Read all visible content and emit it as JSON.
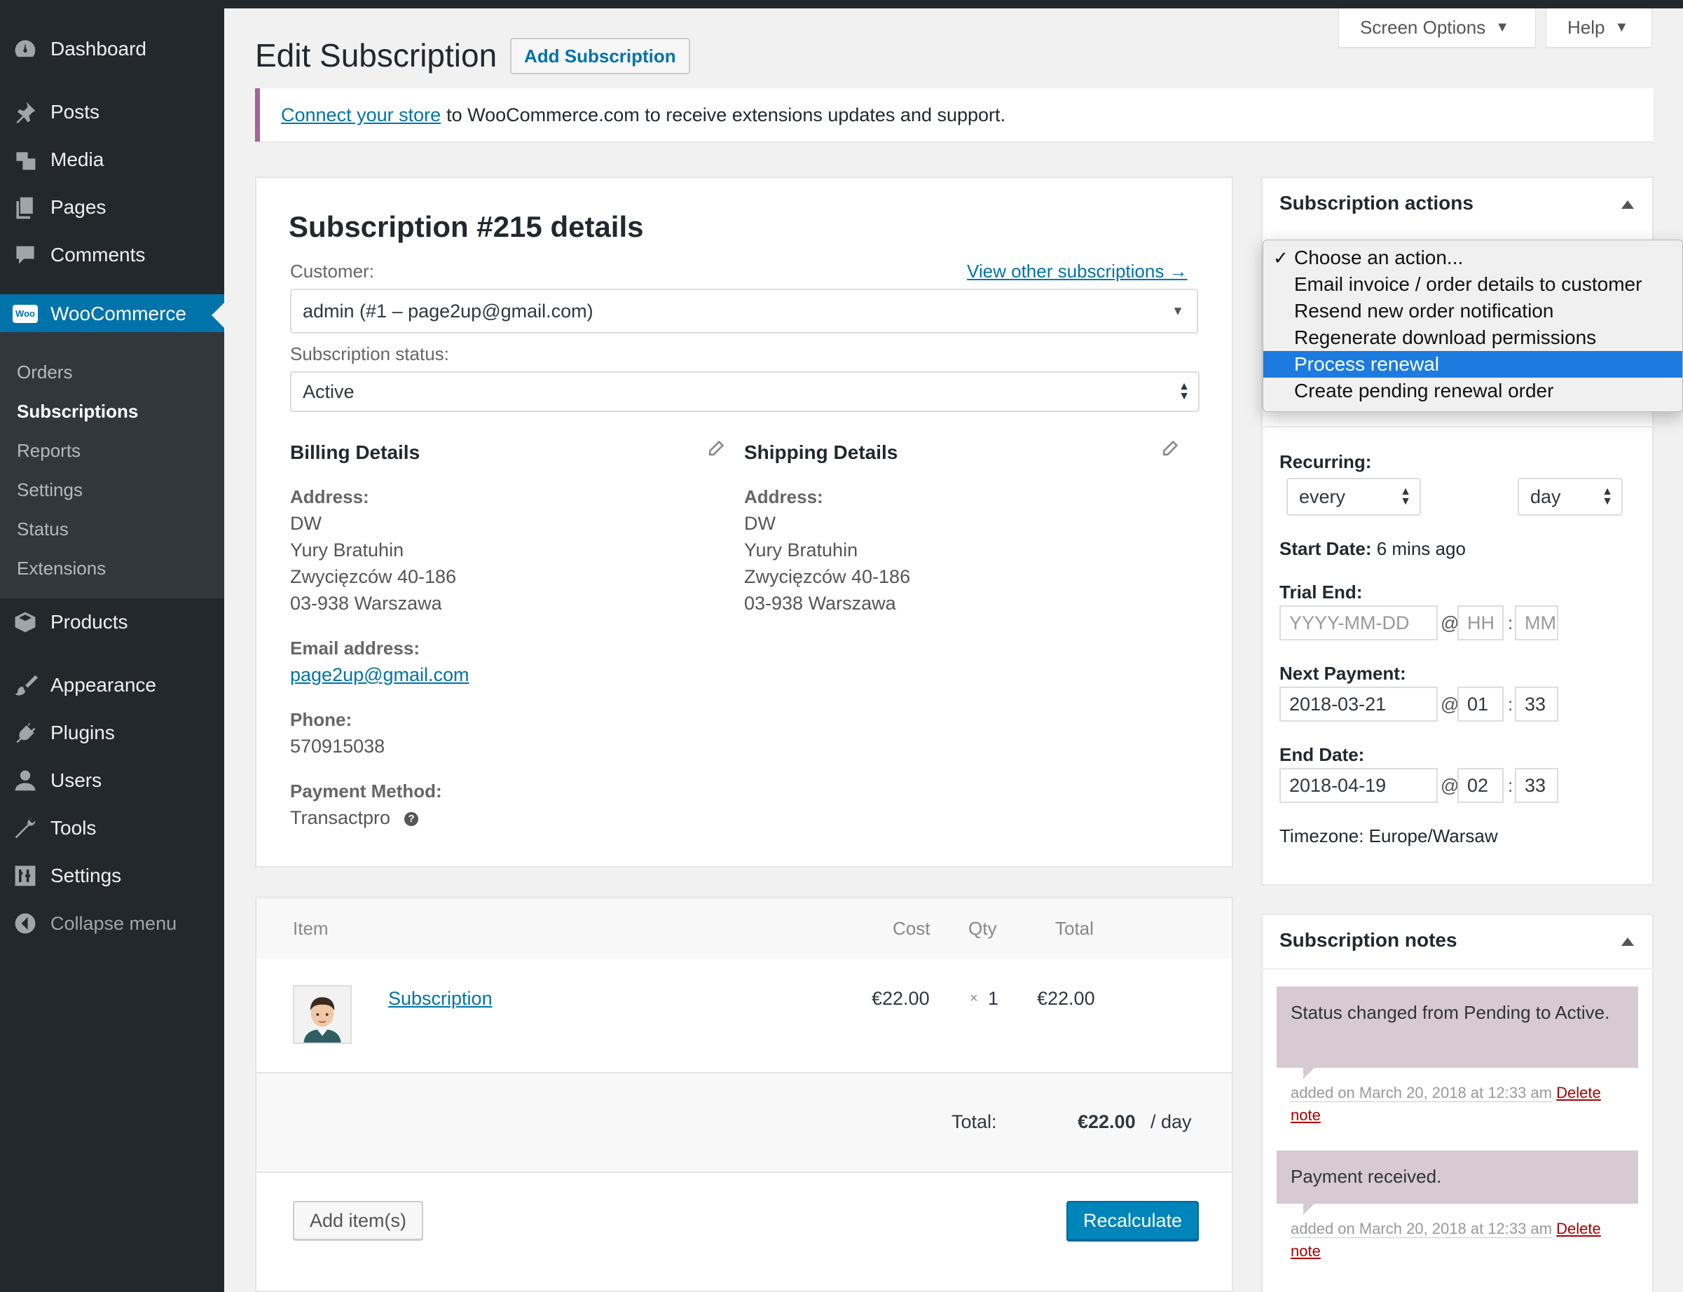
{
  "sidebar": {
    "dashboard": "Dashboard",
    "posts": "Posts",
    "media": "Media",
    "pages": "Pages",
    "comments": "Comments",
    "woocommerce": "WooCommerce",
    "woo_logo": "Woo",
    "sub": {
      "orders": "Orders",
      "subscriptions": "Subscriptions",
      "reports": "Reports",
      "settings": "Settings",
      "status": "Status",
      "extensions": "Extensions"
    },
    "products": "Products",
    "appearance": "Appearance",
    "plugins": "Plugins",
    "users": "Users",
    "tools": "Tools",
    "settings": "Settings",
    "collapse": "Collapse menu"
  },
  "header": {
    "title": "Edit Subscription",
    "add_button": "Add Subscription",
    "screen_options": "Screen Options",
    "help": "Help"
  },
  "notice": {
    "link": "Connect your store",
    "text": "to WooCommerce.com to receive extensions updates and support."
  },
  "details": {
    "title": "Subscription #215 details",
    "customer_label": "Customer:",
    "view_other": "View other subscriptions →",
    "customer_value": "admin (#1 – page2up@gmail.com)",
    "status_label": "Subscription status:",
    "status_value": "Active",
    "billing": {
      "title": "Billing Details",
      "address_label": "Address:",
      "address_lines": [
        "DW",
        "Yury Bratuhin",
        "Zwycięzców 40-186",
        "03-938 Warszawa"
      ],
      "email_label": "Email address:",
      "email": "page2up@gmail.com",
      "phone_label": "Phone:",
      "phone": "570915038",
      "payment_label": "Payment Method:",
      "payment": "Transactpro",
      "help_glyph": "?"
    },
    "shipping": {
      "title": "Shipping Details",
      "address_label": "Address:",
      "address_lines": [
        "DW",
        "Yury Bratuhin",
        "Zwycięzców 40-186",
        "03-938 Warszawa"
      ]
    }
  },
  "items": {
    "headers": {
      "item": "Item",
      "cost": "Cost",
      "qty": "Qty",
      "total": "Total"
    },
    "rows": [
      {
        "name": "Subscription",
        "cost": "€22.00",
        "qty_x": "×",
        "qty": "1",
        "total": "€22.00"
      }
    ],
    "total_label": "Total:",
    "total_value": "€22.00",
    "total_period": "/ day",
    "add_items": "Add item(s)",
    "recalculate": "Recalculate"
  },
  "actions": {
    "title": "Subscription actions",
    "options": [
      "Choose an action...",
      "Email invoice / order details to customer",
      "Resend new order notification",
      "Regenerate download permissions",
      "Process renewal",
      "Create pending renewal order"
    ],
    "checked_glyph": "✓"
  },
  "schedule": {
    "recurring_label": "Recurring:",
    "interval": "every",
    "period": "day",
    "start_label": "Start Date:",
    "start_value": "6 mins ago",
    "trial_label": "Trial End:",
    "trial_date_ph": "YYYY-MM-DD",
    "hour_ph": "HH",
    "minute_ph": "MM",
    "next_label": "Next Payment:",
    "next_date": "2018-03-21",
    "next_hour": "01",
    "next_min": "33",
    "end_label": "End Date:",
    "end_date": "2018-04-19",
    "end_hour": "02",
    "end_min": "33",
    "at": "@",
    "colon": ":",
    "timezone": "Timezone: Europe/Warsaw"
  },
  "notes": {
    "title": "Subscription notes",
    "items": [
      {
        "text": "Status changed from Pending to Active.",
        "meta": "added on March 20, 2018 at 12:33 am",
        "delete_a": "Delete",
        "delete_b": "note"
      },
      {
        "text": "Payment received.",
        "meta": "added on March 20, 2018 at 12:33 am",
        "delete_a": "Delete",
        "delete_b": "note"
      }
    ]
  },
  "colors": {
    "sidebar": "#23282d",
    "accent": "#0073aa",
    "woo": "#a46497",
    "note_bg": "#d7cad2",
    "dropdown_highlight": "#1d7be0"
  }
}
